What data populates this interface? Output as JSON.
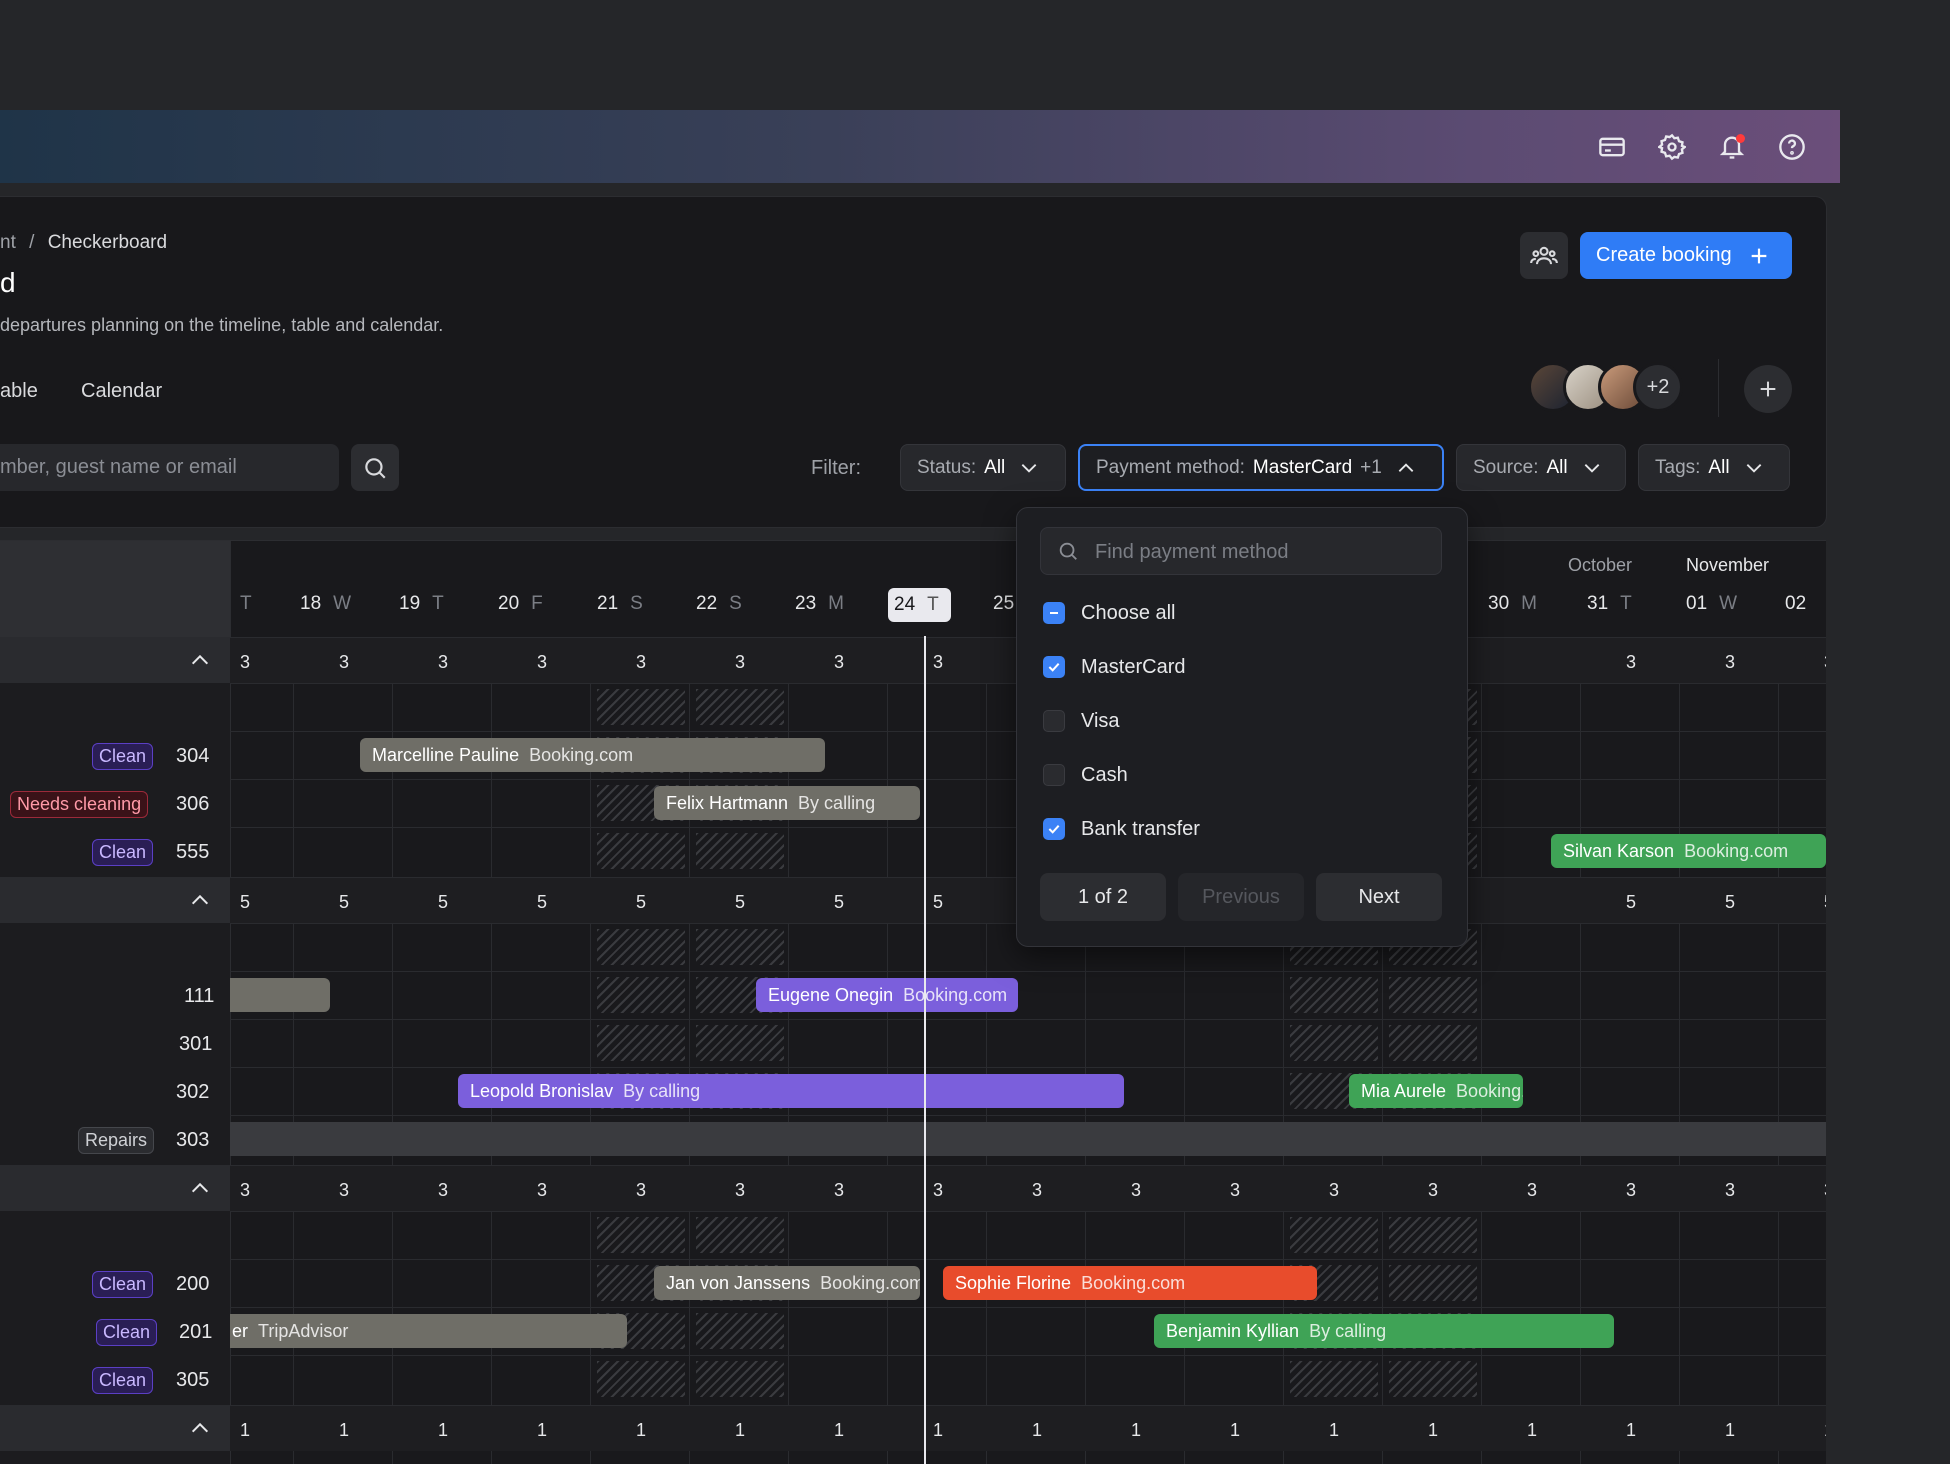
{
  "header": {
    "icons": [
      "credit-card-icon",
      "gear-icon",
      "bell-icon",
      "help-icon"
    ],
    "notification_dot_color": "#ff3b3b"
  },
  "page": {
    "breadcrumb_prev": "nt",
    "breadcrumb_sep": "/",
    "breadcrumb_current": "Checkerboard",
    "title": "d",
    "subtitle": "departures planning on the timeline, table and calendar.",
    "create_booking_label": "Create booking",
    "tabs": [
      "able",
      "Calendar"
    ],
    "avatars_more": "+2"
  },
  "search": {
    "placeholder": "mber, guest name or email"
  },
  "filters": {
    "label": "Filter:",
    "status": {
      "label": "Status:",
      "value": "All"
    },
    "payment": {
      "label": "Payment method:",
      "value": "MasterCard",
      "extra": "+1"
    },
    "source": {
      "label": "Source:",
      "value": "All"
    },
    "tags": {
      "label": "Tags:",
      "value": "All"
    }
  },
  "dropdown": {
    "search_placeholder": "Find payment method",
    "choose_all": "Choose all",
    "options": [
      {
        "label": "MasterCard",
        "checked": true
      },
      {
        "label": "Visa",
        "checked": false
      },
      {
        "label": "Cash",
        "checked": false
      },
      {
        "label": "Bank transfer",
        "checked": true
      }
    ],
    "page_indicator": "1 of 2",
    "previous_label": "Previous",
    "next_label": "Next"
  },
  "timeline": {
    "months": [
      "October",
      "November"
    ],
    "days": [
      {
        "num": "",
        "dow": "T"
      },
      {
        "num": "18",
        "dow": "W"
      },
      {
        "num": "19",
        "dow": "T"
      },
      {
        "num": "20",
        "dow": "F"
      },
      {
        "num": "21",
        "dow": "S"
      },
      {
        "num": "22",
        "dow": "S"
      },
      {
        "num": "23",
        "dow": "M"
      },
      {
        "num": "24",
        "dow": "T"
      },
      {
        "num": "25",
        "dow": ""
      },
      {
        "num": "30",
        "dow": "M"
      },
      {
        "num": "31",
        "dow": "T"
      },
      {
        "num": "01",
        "dow": "W"
      },
      {
        "num": "02",
        "dow": ""
      }
    ],
    "group_counts": [
      "3",
      "5",
      "3",
      "1"
    ],
    "rooms": [
      {
        "num": "304",
        "badge": "Clean",
        "kind": "clean"
      },
      {
        "num": "306",
        "badge": "Needs cleaning",
        "kind": "needs"
      },
      {
        "num": "555",
        "badge": "Clean",
        "kind": "clean"
      },
      {
        "num": "111",
        "badge": "",
        "kind": ""
      },
      {
        "num": "301",
        "badge": "",
        "kind": ""
      },
      {
        "num": "302",
        "badge": "",
        "kind": ""
      },
      {
        "num": "303",
        "badge": "Repairs",
        "kind": "repairs"
      },
      {
        "num": "200",
        "badge": "Clean",
        "kind": "clean"
      },
      {
        "num": "201",
        "badge": "Clean",
        "kind": "clean"
      },
      {
        "num": "305",
        "badge": "Clean",
        "kind": "clean"
      }
    ],
    "bookings": [
      {
        "guest": "Marcelline Pauline",
        "source": "Booking.com",
        "color": "gray"
      },
      {
        "guest": "Felix Hartmann",
        "source": "By calling",
        "color": "gray"
      },
      {
        "guest": "Silvan Karson",
        "source": "Booking.com",
        "color": "green"
      },
      {
        "guest": "",
        "source": "",
        "color": "gray"
      },
      {
        "guest": "Eugene Onegin",
        "source": "Booking.com",
        "color": "purple"
      },
      {
        "guest": "Leopold Bronislav",
        "source": "By calling",
        "color": "purple"
      },
      {
        "guest": "Mia Aurele",
        "source": "Booking.com",
        "color": "green"
      },
      {
        "guest": "Jan von Janssens",
        "source": "Booking.com",
        "color": "gray"
      },
      {
        "guest": "Sophie Florine",
        "source": "Booking.com",
        "color": "orange"
      },
      {
        "guest": "er",
        "source": "TripAdvisor",
        "color": "gray"
      },
      {
        "guest": "Benjamin Kyllian",
        "source": "By calling",
        "color": "green"
      }
    ]
  }
}
